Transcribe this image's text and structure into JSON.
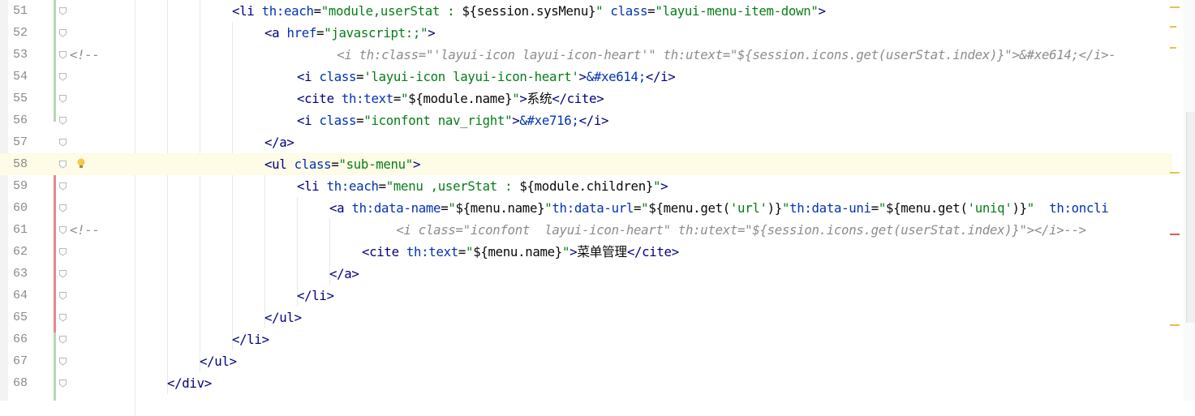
{
  "editor": {
    "current_line": 58,
    "lines": [
      {
        "num": "51",
        "indent": 286,
        "segments": [
          {
            "t": "<li ",
            "c": "tag"
          },
          {
            "t": "th:each",
            "c": "attr"
          },
          {
            "t": "=",
            "c": "plain"
          },
          {
            "t": "\"module,userStat : ",
            "c": "str"
          },
          {
            "t": "${session.sysMenu}",
            "c": "plain"
          },
          {
            "t": "\" ",
            "c": "str"
          },
          {
            "t": "class",
            "c": "attr"
          },
          {
            "t": "=",
            "c": "plain"
          },
          {
            "t": "\"layui-menu-item-down\"",
            "c": "str"
          },
          {
            "t": ">",
            "c": "tag"
          }
        ]
      },
      {
        "num": "52",
        "indent": 326,
        "segments": [
          {
            "t": "<a ",
            "c": "tag"
          },
          {
            "t": "href",
            "c": "attr"
          },
          {
            "t": "=",
            "c": "plain"
          },
          {
            "t": "\"javascript:;\"",
            "c": "str"
          },
          {
            "t": ">",
            "c": "tag"
          }
        ]
      },
      {
        "num": "53",
        "indent": 86,
        "segments": [
          {
            "t": "<!--                                ",
            "c": "cmt"
          },
          {
            "t": "<i th:class=\"'layui-icon layui-icon-heart'\" th:utext=\"${session.icons.get(userStat.index)}\">&#xe614;</i>-",
            "c": "cmt"
          }
        ]
      },
      {
        "num": "54",
        "indent": 366,
        "segments": [
          {
            "t": "<i ",
            "c": "tag"
          },
          {
            "t": "class",
            "c": "attr"
          },
          {
            "t": "=",
            "c": "plain"
          },
          {
            "t": "'layui-icon layui-icon-heart'",
            "c": "str"
          },
          {
            "t": ">",
            "c": "tag"
          },
          {
            "t": "&#xe614;",
            "c": "ent"
          },
          {
            "t": "</i>",
            "c": "tag"
          }
        ]
      },
      {
        "num": "55",
        "indent": 366,
        "segments": [
          {
            "t": "<cite ",
            "c": "tag"
          },
          {
            "t": "th:text",
            "c": "attr"
          },
          {
            "t": "=",
            "c": "plain"
          },
          {
            "t": "\"",
            "c": "str"
          },
          {
            "t": "${module.name}",
            "c": "plain"
          },
          {
            "t": "\"",
            "c": "str"
          },
          {
            "t": ">",
            "c": "tag"
          },
          {
            "t": "系统",
            "c": "plain"
          },
          {
            "t": "</cite>",
            "c": "tag"
          }
        ]
      },
      {
        "num": "56",
        "indent": 366,
        "segments": [
          {
            "t": "<i ",
            "c": "tag"
          },
          {
            "t": "class",
            "c": "attr"
          },
          {
            "t": "=",
            "c": "plain"
          },
          {
            "t": "\"iconfont nav_right\"",
            "c": "str"
          },
          {
            "t": ">",
            "c": "tag"
          },
          {
            "t": "&#xe716;",
            "c": "ent"
          },
          {
            "t": "</i>",
            "c": "tag"
          }
        ]
      },
      {
        "num": "57",
        "indent": 326,
        "segments": [
          {
            "t": "</a>",
            "c": "tag"
          }
        ]
      },
      {
        "num": "58",
        "indent": 326,
        "segments": [
          {
            "t": "<ul ",
            "c": "tag"
          },
          {
            "t": "class",
            "c": "attr"
          },
          {
            "t": "=",
            "c": "plain"
          },
          {
            "t": "\"sub-menu\"",
            "c": "str"
          },
          {
            "t": ">",
            "c": "tag"
          }
        ]
      },
      {
        "num": "59",
        "indent": 366,
        "segments": [
          {
            "t": "<li ",
            "c": "tag"
          },
          {
            "t": "th:each",
            "c": "attr"
          },
          {
            "t": "=",
            "c": "plain"
          },
          {
            "t": "\"menu ,userStat : ",
            "c": "str"
          },
          {
            "t": "${module.children}",
            "c": "plain"
          },
          {
            "t": "\"",
            "c": "str"
          },
          {
            "t": ">",
            "c": "tag"
          }
        ]
      },
      {
        "num": "60",
        "indent": 406,
        "segments": [
          {
            "t": "<a ",
            "c": "tag"
          },
          {
            "t": "th:data-name",
            "c": "attr"
          },
          {
            "t": "=",
            "c": "plain"
          },
          {
            "t": "\"",
            "c": "str"
          },
          {
            "t": "${menu.name}",
            "c": "plain"
          },
          {
            "t": "\"",
            "c": "str"
          },
          {
            "t": "th:data-url",
            "c": "attr"
          },
          {
            "t": "=",
            "c": "plain"
          },
          {
            "t": "\"",
            "c": "str"
          },
          {
            "t": "${menu.get(",
            "c": "plain"
          },
          {
            "t": "'url'",
            "c": "str"
          },
          {
            "t": ")}",
            "c": "plain"
          },
          {
            "t": "\"",
            "c": "str"
          },
          {
            "t": "th:data-uni",
            "c": "attr"
          },
          {
            "t": "=",
            "c": "plain"
          },
          {
            "t": "\"",
            "c": "str"
          },
          {
            "t": "${menu.get(",
            "c": "plain"
          },
          {
            "t": "'uniq'",
            "c": "str"
          },
          {
            "t": ")}",
            "c": "plain"
          },
          {
            "t": "\"  ",
            "c": "str"
          },
          {
            "t": "th:oncli",
            "c": "attr"
          }
        ]
      },
      {
        "num": "61",
        "indent": 86,
        "segments": [
          {
            "t": "<!--                                        ",
            "c": "cmt"
          },
          {
            "t": "<i class=\"iconfont  layui-icon-heart\" th:utext=\"${session.icons.get(userStat.index)}\"></i>-->",
            "c": "cmt"
          }
        ]
      },
      {
        "num": "62",
        "indent": 446,
        "segments": [
          {
            "t": "<cite ",
            "c": "tag"
          },
          {
            "t": "th:text",
            "c": "attr"
          },
          {
            "t": "=",
            "c": "plain"
          },
          {
            "t": "\"",
            "c": "str"
          },
          {
            "t": "${menu.name}",
            "c": "plain"
          },
          {
            "t": "\"",
            "c": "str"
          },
          {
            "t": ">",
            "c": "tag"
          },
          {
            "t": "菜单管理",
            "c": "plain"
          },
          {
            "t": "</cite>",
            "c": "tag"
          }
        ]
      },
      {
        "num": "63",
        "indent": 406,
        "segments": [
          {
            "t": "</a>",
            "c": "tag"
          }
        ]
      },
      {
        "num": "64",
        "indent": 366,
        "segments": [
          {
            "t": "</li>",
            "c": "tag"
          }
        ]
      },
      {
        "num": "65",
        "indent": 326,
        "segments": [
          {
            "t": "</ul>",
            "c": "tag"
          }
        ]
      },
      {
        "num": "66",
        "indent": 286,
        "segments": [
          {
            "t": "</li>",
            "c": "tag"
          }
        ]
      },
      {
        "num": "67",
        "indent": 246,
        "segments": [
          {
            "t": "</ul>",
            "c": "tag"
          }
        ]
      },
      {
        "num": "68",
        "indent": 206,
        "segments": [
          {
            "t": "</div>",
            "c": "tag"
          }
        ]
      }
    ]
  },
  "colors": {
    "tag": "#000080",
    "attribute": "#0033b3",
    "string": "#067d17",
    "comment": "#8c8c8c",
    "current_line": "#fefbe6",
    "line_number": "#8a8a8a"
  },
  "icons": {
    "intention_bulb": "bulb-icon",
    "fold_marker": "fold-icon"
  }
}
